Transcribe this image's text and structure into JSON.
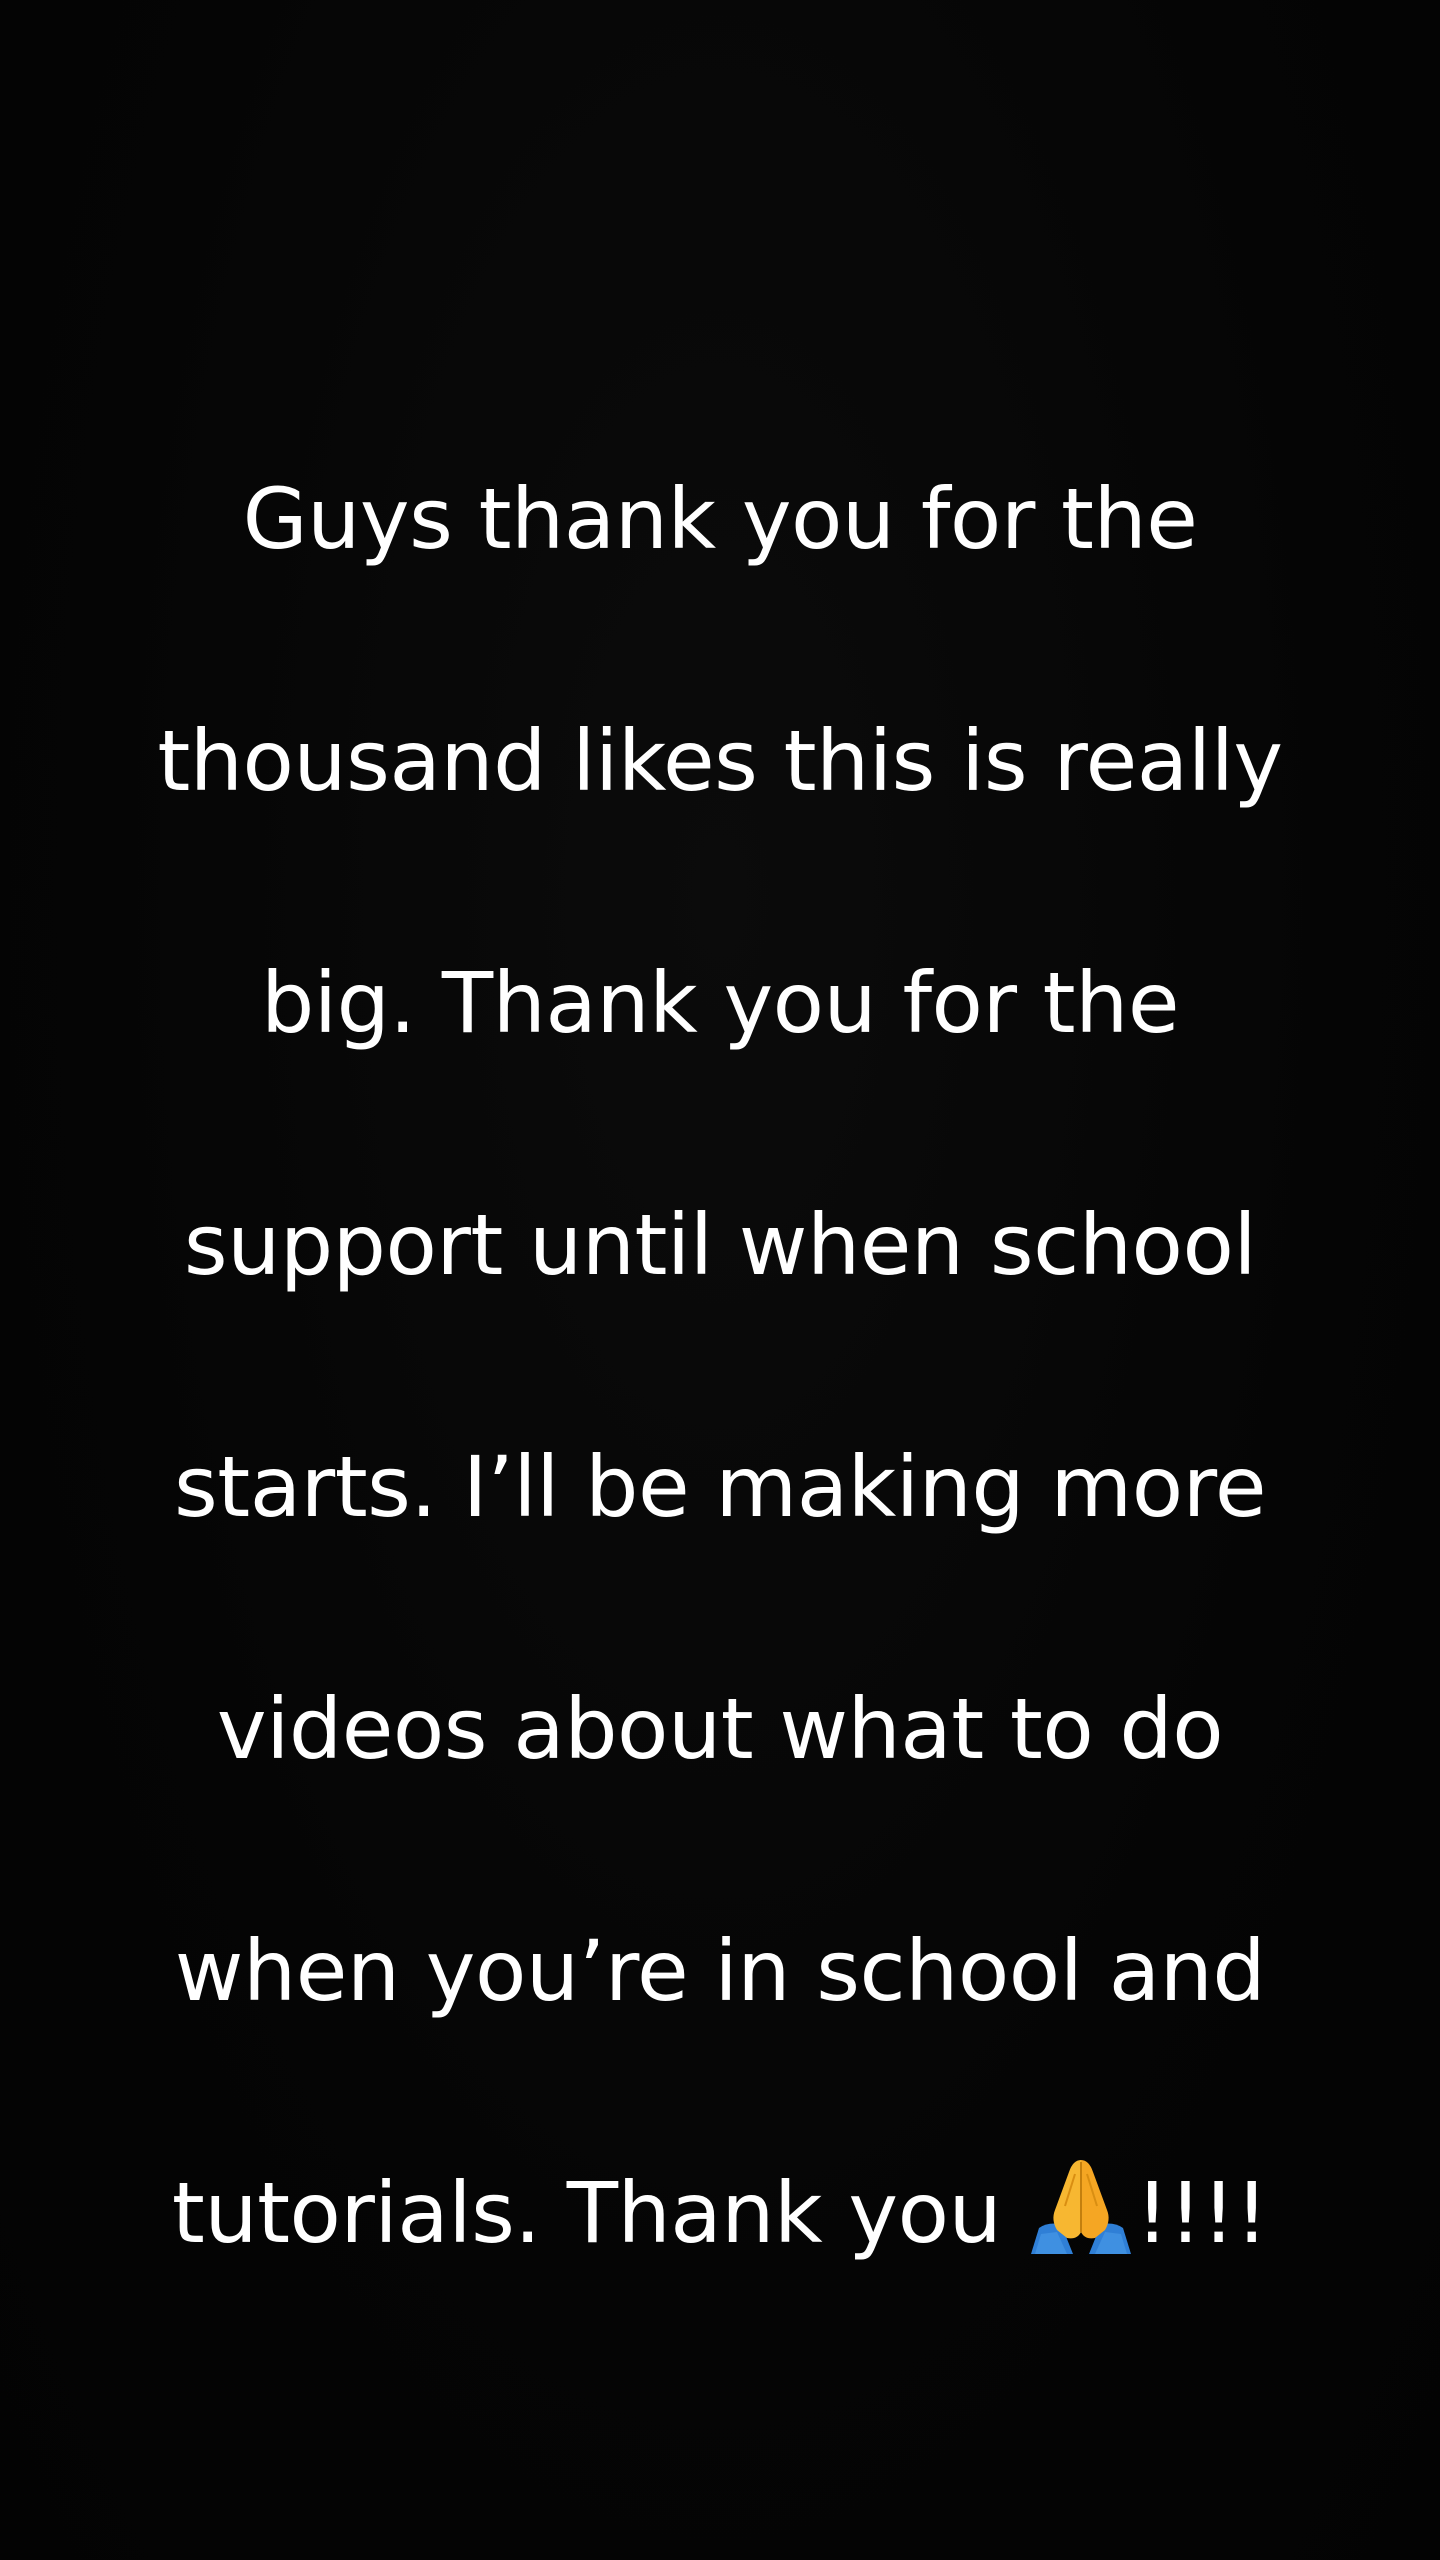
{
  "story": {
    "lines": [
      "Guys thank you for the",
      "thousand likes this is really",
      "big. Thank you for the",
      "support until when school",
      "starts. I’ll be making more",
      "videos about what to do",
      "when you’re in school and",
      "tutorials. Thank you"
    ],
    "trailing": "!!!!",
    "emoji_icon": "folded-hands-icon",
    "text_color": "#ffffff",
    "background_color": "#050505"
  }
}
